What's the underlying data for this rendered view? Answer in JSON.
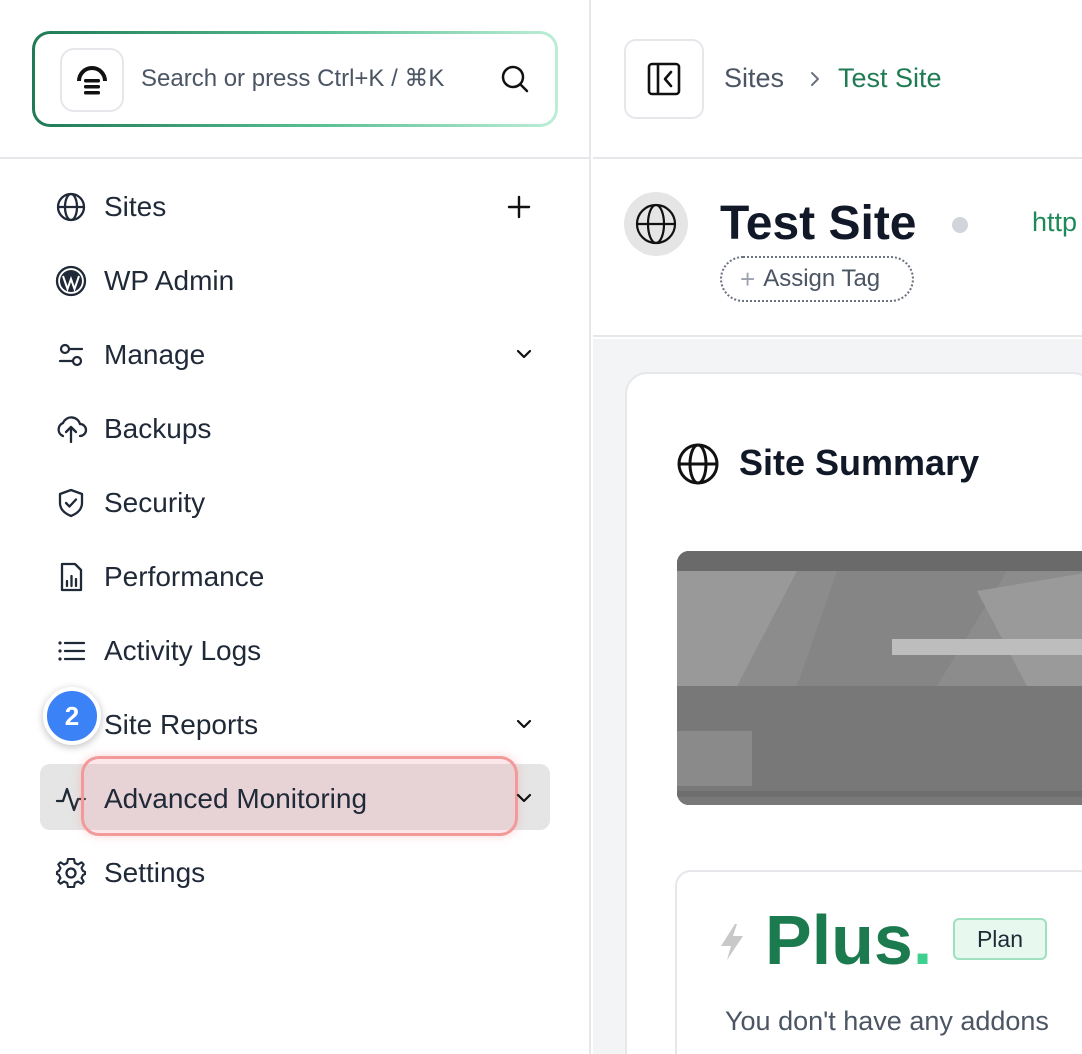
{
  "search": {
    "placeholder": "Search or press Ctrl+K / ⌘K"
  },
  "sidebar": {
    "items": [
      {
        "label": "Sites",
        "icon": "globe-icon",
        "action": "plus"
      },
      {
        "label": "WP Admin",
        "icon": "wordpress-icon"
      },
      {
        "label": "Manage",
        "icon": "sliders-icon",
        "action": "chevron"
      },
      {
        "label": "Backups",
        "icon": "cloud-upload-icon"
      },
      {
        "label": "Security",
        "icon": "shield-check-icon"
      },
      {
        "label": "Performance",
        "icon": "report-chart-icon"
      },
      {
        "label": "Activity Logs",
        "icon": "list-icon"
      },
      {
        "label": "Site Reports",
        "icon": "report-icon",
        "action": "chevron"
      },
      {
        "label": "Advanced Monitoring",
        "icon": "activity-pulse-icon",
        "action": "chevron",
        "active": true
      },
      {
        "label": "Settings",
        "icon": "gear-icon"
      }
    ],
    "step_badge": "2"
  },
  "breadcrumb": {
    "root": "Sites",
    "current": "Test Site"
  },
  "site": {
    "title": "Test Site",
    "url": "http",
    "assign_tag": "Assign Tag",
    "status_color": "#d1d5db"
  },
  "summary": {
    "title": "Site Summary",
    "plan_name": "Plus",
    "plan_dot": ".",
    "plan_badge": "Plan",
    "plan_desc": "You don't have any addons"
  },
  "colors": {
    "accent": "#1e7b53",
    "badge": "#3b82f6",
    "highlight": "#f29a9a"
  }
}
